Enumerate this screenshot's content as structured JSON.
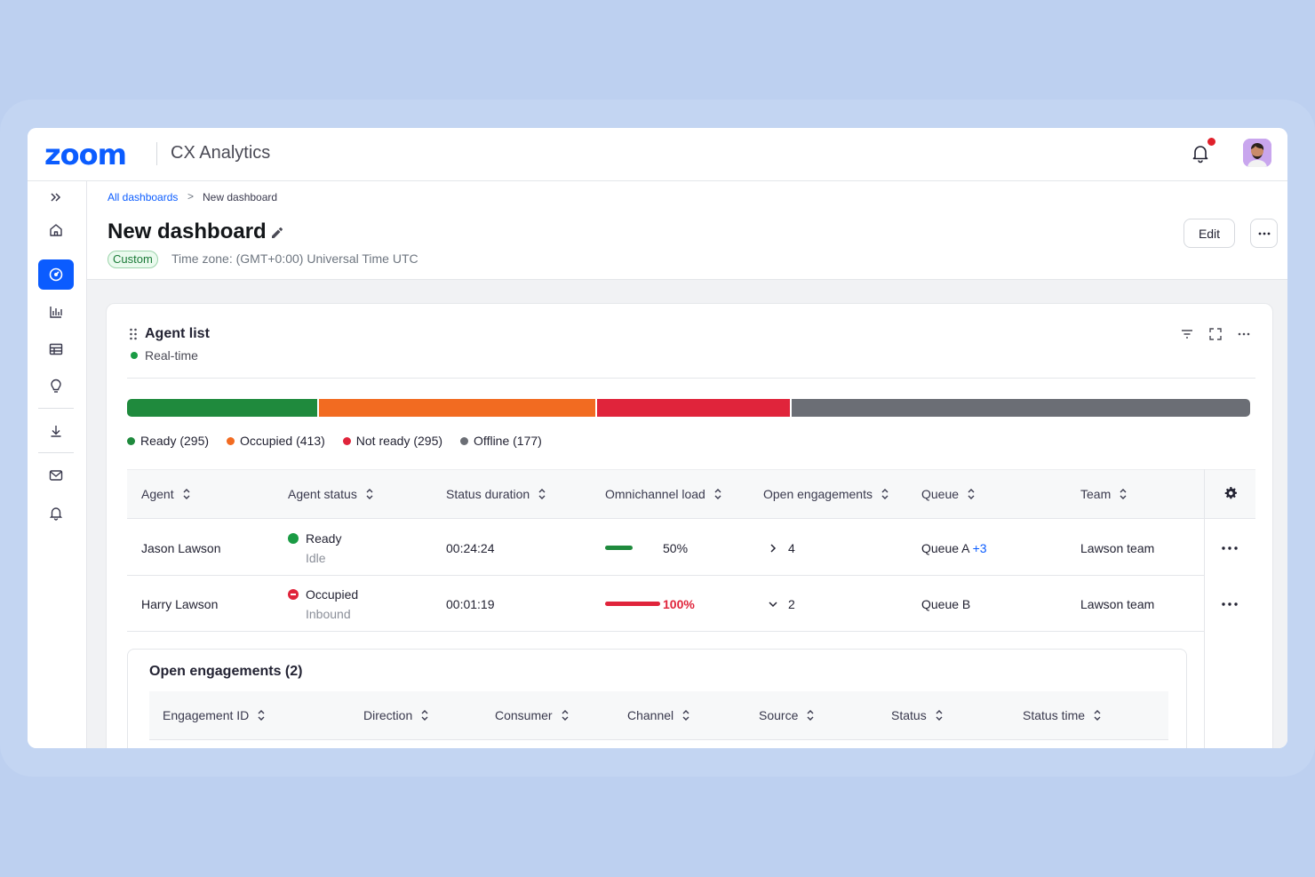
{
  "app": {
    "logo_text": "zoom",
    "name": "CX Analytics"
  },
  "header": {
    "notification_dot_color": "#e0202b"
  },
  "sidebar": {
    "items": [
      {
        "name": "expand-icon"
      },
      {
        "name": "home-icon"
      },
      {
        "name": "dashboard-icon",
        "active": true
      },
      {
        "name": "bar-chart-icon"
      },
      {
        "name": "table-icon"
      },
      {
        "name": "lightbulb-icon"
      },
      {
        "name": "download-icon"
      },
      {
        "name": "mail-icon"
      },
      {
        "name": "bell-icon"
      }
    ]
  },
  "breadcrumb": {
    "parent": "All dashboards",
    "separator": ">",
    "current": "New dashboard"
  },
  "page": {
    "title": "New dashboard",
    "badge": "Custom",
    "timezone": "Time zone: (GMT+0:00) Universal Time UTC",
    "edit_label": "Edit",
    "more_label": "···"
  },
  "widget": {
    "title": "Agent list",
    "realtime_label": "Real-time",
    "status_segments": [
      {
        "label": "Ready (295)",
        "color": "#1f8a3d",
        "count": 295
      },
      {
        "label": "Occupied (413)",
        "color": "#f26b21",
        "count": 413
      },
      {
        "label": "Not ready (295)",
        "color": "#e0243b",
        "count": 295
      },
      {
        "label": "Offline (177)",
        "color": "#6b6e75",
        "count": 177
      }
    ],
    "segment_fractions": [
      0.17,
      0.247,
      0.173,
      0.41
    ],
    "columns": [
      "Agent",
      "Agent status",
      "Status duration",
      "Omnichannel load",
      "Open engagements",
      "Queue",
      "Team"
    ],
    "rows": [
      {
        "agent": "Jason Lawson",
        "status": "Ready",
        "substatus": "Idle",
        "status_color": "#1a9b44",
        "duration": "00:24:24",
        "load_pct": 50,
        "load_label": "50%",
        "load_color": "#1f8a3d",
        "open": "4",
        "expanded": false,
        "queue": "Queue A",
        "queue_extra": "+3",
        "team": "Lawson team"
      },
      {
        "agent": "Harry Lawson",
        "status": "Occupied",
        "substatus": "Inbound",
        "status_color": "#e0243b",
        "duration": "00:01:19",
        "load_pct": 100,
        "load_label": "100%",
        "load_color": "#e0243b",
        "open": "2",
        "expanded": true,
        "queue": "Queue B",
        "queue_extra": "",
        "team": "Lawson team"
      }
    ],
    "engagements": {
      "title": "Open engagements (2)",
      "columns": [
        "Engagement ID",
        "Direction",
        "Consumer",
        "Channel",
        "Source",
        "Status",
        "Status time"
      ]
    }
  }
}
